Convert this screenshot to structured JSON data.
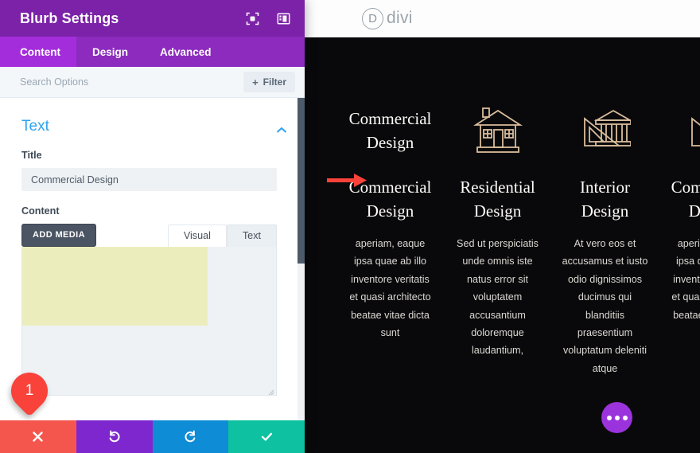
{
  "panel": {
    "title": "Blurb Settings",
    "header_icons": [
      {
        "name": "focus-frame-icon"
      },
      {
        "name": "panel-layout-icon"
      }
    ],
    "tabs": [
      {
        "label": "Content",
        "active": true
      },
      {
        "label": "Design",
        "active": false
      },
      {
        "label": "Advanced",
        "active": false
      }
    ],
    "search": {
      "placeholder": "Search Options",
      "value": "",
      "filter_label": "Filter",
      "filter_plus": "+"
    },
    "section": {
      "title": "Text",
      "collapse_icon": "chevron-up-icon",
      "title_label": "Title",
      "title_value": "Commercial Design",
      "content_label": "Content",
      "add_media_label": "ADD MEDIA",
      "editor_tabs": [
        {
          "label": "Visual",
          "active": true
        },
        {
          "label": "Text",
          "active": false
        }
      ],
      "editor_value": ""
    },
    "callout": {
      "number": "1"
    },
    "actions": [
      {
        "name": "cancel-button",
        "icon": "close-icon",
        "color": "#f4564e"
      },
      {
        "name": "undo-button",
        "icon": "undo-icon",
        "color": "#7f27cf"
      },
      {
        "name": "redo-button",
        "icon": "redo-icon",
        "color": "#0e8cd6"
      },
      {
        "name": "save-button",
        "icon": "check-icon",
        "color": "#0ec1a0"
      }
    ]
  },
  "preview": {
    "logo": {
      "mark": "D",
      "word": "divi"
    },
    "columns": [
      {
        "icon": "missing-icon-text",
        "icon_text": "Commercial Design",
        "title": "Commercial Design",
        "body": "aperiam, eaque ipsa quae ab illo inventore veritatis et quasi architecto beatae vitae dicta sunt"
      },
      {
        "icon": "house-icon",
        "icon_text": "",
        "title": "Residential Design",
        "body": "Sed ut perspiciatis unde omnis iste natus error sit voluptatem accusantium doloremque laudantium,"
      },
      {
        "icon": "classical-building-ruler-icon",
        "icon_text": "",
        "title": "Interior Design",
        "body": "At vero eos et accusamus et iusto odio dignissimos ducimus qui blanditiis praesentium voluptatum deleniti atque"
      },
      {
        "icon": "classical-building-ruler-icon",
        "icon_text": "",
        "title": "Commercial Design",
        "body": "aperiam, eaque ipsa quae ab illo inventore veritatis et quasi architecto beatae vitae dicta sunt"
      }
    ],
    "fab": {
      "name": "more-options-button"
    },
    "annotation_arrow": {
      "color": "#f9423a"
    }
  },
  "colors": {
    "purple_header": "#7b22a8",
    "purple_tabs": "#8c2bbd",
    "purple_active_tab": "#a32ddb",
    "accent_blue": "#2ea3f2",
    "callout_red": "#f9423a",
    "highlight_yellow": "#ecedbc",
    "preview_bg": "#09090b",
    "icon_tan": "#d9bd9c"
  }
}
